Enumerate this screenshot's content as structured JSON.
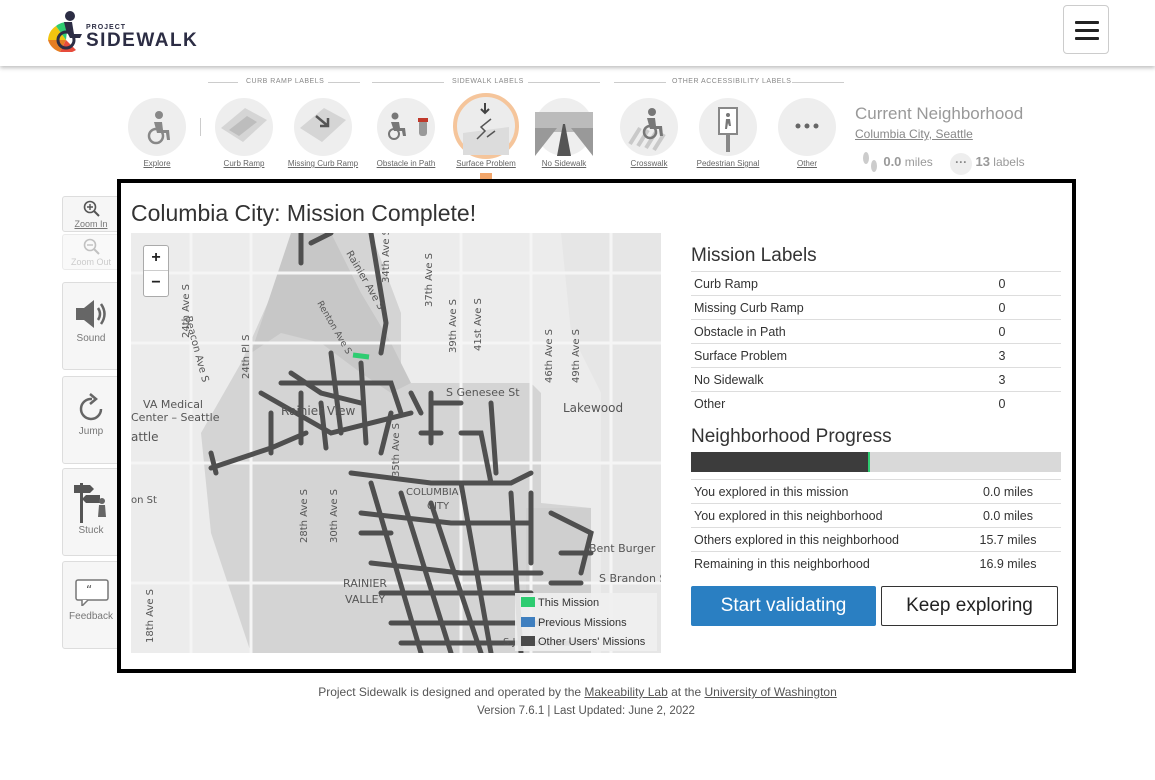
{
  "brand": {
    "project": "PROJECT",
    "name": "SIDEWALK"
  },
  "toolbar": {
    "sections": [
      "CURB RAMP LABELS",
      "SIDEWALK LABELS",
      "OTHER ACCESSIBILITY LABELS"
    ],
    "tools": [
      {
        "label": "Explore",
        "icon": "wheelchair-user-icon"
      },
      {
        "label": "Curb Ramp",
        "icon": "curb-ramp-icon"
      },
      {
        "label": "Missing Curb Ramp",
        "icon": "missing-curb-ramp-icon"
      },
      {
        "label": "Obstacle in Path",
        "icon": "obstacle-icon"
      },
      {
        "label": "Surface Problem",
        "icon": "surface-problem-icon",
        "active": true
      },
      {
        "label": "No Sidewalk",
        "icon": "no-sidewalk-icon"
      },
      {
        "label": "Crosswalk",
        "icon": "crosswalk-icon"
      },
      {
        "label": "Pedestrian Signal",
        "icon": "pedestrian-signal-icon"
      },
      {
        "label": "Other",
        "icon": "more-icon"
      }
    ]
  },
  "neighborhood": {
    "title": "Current Neighborhood",
    "name": "Columbia City, Seattle",
    "miles": "0.0",
    "miles_unit": "miles",
    "labels": "13",
    "labels_unit": "labels"
  },
  "controls": {
    "zoom_in": "Zoom In",
    "zoom_out": "Zoom Out",
    "sound": "Sound",
    "jump": "Jump",
    "stuck": "Stuck",
    "feedback": "Feedback"
  },
  "modal": {
    "title": "Columbia City: Mission Complete!",
    "mission_labels_title": "Mission Labels",
    "mission_labels": [
      {
        "name": "Curb Ramp",
        "count": "0"
      },
      {
        "name": "Missing Curb Ramp",
        "count": "0"
      },
      {
        "name": "Obstacle in Path",
        "count": "0"
      },
      {
        "name": "Surface Problem",
        "count": "3"
      },
      {
        "name": "No Sidewalk",
        "count": "3"
      },
      {
        "name": "Other",
        "count": "0"
      }
    ],
    "progress_title": "Neighborhood Progress",
    "progress_fraction": 0.48,
    "progress_stats": [
      {
        "name": "You explored in this mission",
        "value": "0.0 miles"
      },
      {
        "name": "You explored in this neighborhood",
        "value": "0.0 miles"
      },
      {
        "name": "Others explored in this neighborhood",
        "value": "15.7 miles"
      },
      {
        "name": "Remaining in this neighborhood",
        "value": "16.9 miles"
      }
    ],
    "start_validating": "Start validating",
    "keep_exploring": "Keep exploring",
    "map": {
      "zoom_plus": "+",
      "zoom_minus": "−",
      "legend": [
        {
          "label": "This Mission",
          "color": "#2ecc71"
        },
        {
          "label": "Previous Missions",
          "color": "#3f7fbf"
        },
        {
          "label": "Other Users' Missions",
          "color": "#4a4a4a"
        }
      ],
      "place_labels": [
        "Beacon Ave S",
        "24th Ave S",
        "24th Pl S",
        "VA Medical",
        "Center – Seattle",
        "attle",
        "Rainier Ave S",
        "34th Ave S",
        "37th Ave S",
        "39th Ave S",
        "41st Ave S",
        "46th Ave S",
        "49th Ave S",
        "S Genesee St",
        "Lakewood",
        "Rainier View",
        "35th Ave S",
        "COLUMBIA",
        "CITY",
        "on St",
        "Bent Burger",
        "S Brandon St",
        "28th Ave S",
        "30th Ave S",
        "RAINIER",
        "VALLEY",
        "18th Ave S",
        "S J",
        "Renton Ave S"
      ]
    }
  },
  "footer": {
    "prefix": "Project Sidewalk is designed and operated by the",
    "lab": "Makeability Lab",
    "middle": "at the",
    "uni": "University of Washington",
    "version": "Version 7.6.1 | Last Updated: June 2, 2022"
  }
}
